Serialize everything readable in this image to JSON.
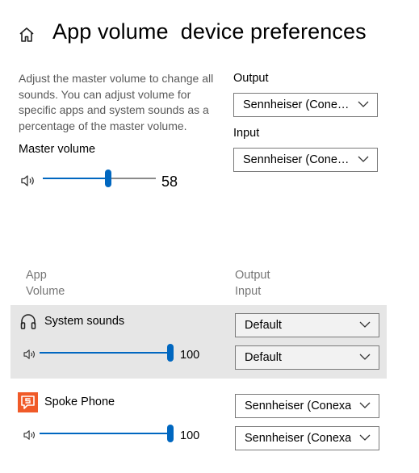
{
  "page": {
    "title": "App volume  device preferences",
    "description": "Adjust the master volume to change all sounds. You can adjust volume for specific apps and system sounds as a percentage of the master volume."
  },
  "master": {
    "label": "Master volume",
    "value": "58",
    "level": 0.58
  },
  "output": {
    "label": "Output",
    "selected": "Sennheiser  (Conexant"
  },
  "input": {
    "label": "Input",
    "selected": "Sennheiser  (Conexant"
  },
  "columns": {
    "app": "App",
    "volume": "Volume",
    "output": "Output",
    "input": "Input"
  },
  "apps": [
    {
      "name": "System sounds",
      "icon": "headphones-icon",
      "volume": "100",
      "level": 1.0,
      "output": "Default",
      "input": "Default"
    },
    {
      "name": "Spoke Phone",
      "icon": "spoke-phone-app-icon",
      "volume": "100",
      "level": 1.0,
      "output": "Sennheiser  (Conexant",
      "input": "Sennheiser  (Conexant"
    }
  ],
  "colors": {
    "accent": "#0067c0",
    "row_highlight": "#e6e6e6",
    "spoke_icon": "#f05a28",
    "muted_text": "#767676"
  }
}
